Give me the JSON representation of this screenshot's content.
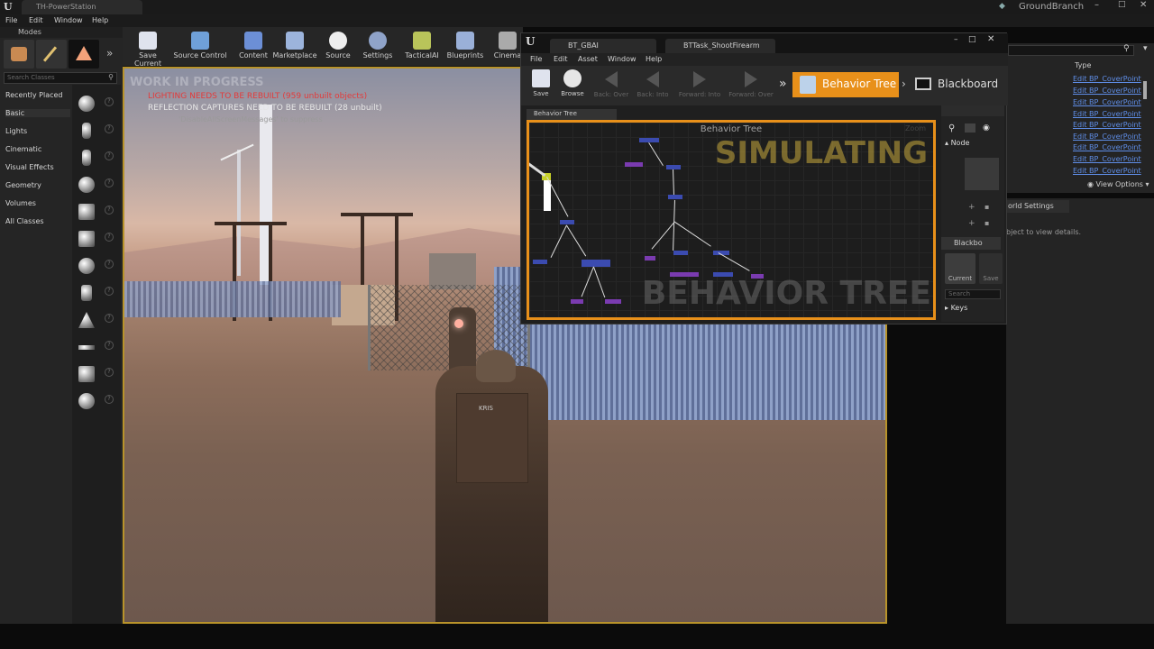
{
  "window": {
    "tab_title": "TH-PowerStation",
    "project_name": "GroundBranch",
    "logo": "U"
  },
  "menu": {
    "file": "File",
    "edit": "Edit",
    "window": "Window",
    "help": "Help"
  },
  "modes": {
    "header": "Modes",
    "search_placeholder": "Search Classes",
    "categories": [
      "Recently Placed",
      "Basic",
      "Lights",
      "Cinematic",
      "Visual Effects",
      "Geometry",
      "Volumes",
      "All Classes"
    ],
    "selected_category": "Basic"
  },
  "toolbar": {
    "buttons": [
      "Save Current",
      "Source Control",
      "Content",
      "Marketplace",
      "Source",
      "Settings",
      "TacticalAI",
      "Blueprints",
      "Cinema"
    ]
  },
  "viewport": {
    "work_in_progress": "WORK IN PROGRESS",
    "lighting_warning": "LIGHTING NEEDS TO BE REBUILT (959 unbuilt objects)",
    "reflection_warning": "REFLECTION CAPTURES NEED TO BE REBUILT (28 unbuilt)",
    "suppress_hint": "'DisableAllScreenMessages' to suppress",
    "vest_label": "KRIS"
  },
  "behavior_tree_window": {
    "tabs": [
      "BT_GBAI",
      "BTTask_ShootFirearm"
    ],
    "menu": {
      "file": "File",
      "edit": "Edit",
      "asset": "Asset",
      "window": "Window",
      "help": "Help"
    },
    "toolbar": {
      "save": "Save",
      "browse": "Browse",
      "back_over": "Back: Over",
      "back_into": "Back: Into",
      "forward_into": "Forward: Into",
      "forward_over": "Forward: Over"
    },
    "mode_behavior_tree": "Behavior Tree",
    "mode_blackboard": "Blackboard",
    "graph_tab": "Behavior Tree",
    "graph_title": "Behavior Tree",
    "zoom": "Zoom",
    "simulating": "SIMULATING",
    "watermark": "BEHAVIOR TREE",
    "side": {
      "node_label": "Node",
      "blackboard_label": "Blackbo",
      "current_label": "Current",
      "save_label": "Save",
      "search_placeholder": "Search",
      "keys_label": "Keys"
    }
  },
  "outliner": {
    "type_header": "Type",
    "rows": [
      "Edit BP_CoverPoint",
      "Edit BP_CoverPoint",
      "Edit BP_CoverPoint",
      "Edit BP_CoverPoint",
      "Edit BP_CoverPoint",
      "Edit BP_CoverPoint",
      "Edit BP_CoverPoint",
      "Edit BP_CoverPoint",
      "Edit BP_CoverPoint"
    ],
    "view_options": "View Options"
  },
  "details": {
    "tab": "orld Settings",
    "empty_hint": "bject to view details."
  },
  "colors": {
    "accent_orange": "#e8901a",
    "warning_red": "#e33b3b",
    "link_blue": "#5f8ee8",
    "viewport_border": "#b8932a"
  }
}
